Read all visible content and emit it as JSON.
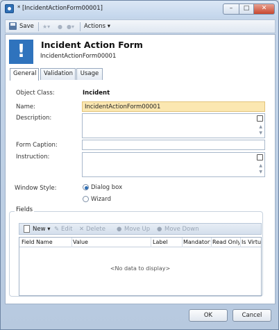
{
  "window": {
    "title": "* [IncidentActionForm00001]"
  },
  "toolbar": {
    "save_label": "Save",
    "actions_label": "Actions ▾"
  },
  "header": {
    "title": "Incident Action Form",
    "subtitle": "IncidentActionForm00001",
    "icon_glyph": "!"
  },
  "tabs": [
    {
      "label": "General"
    },
    {
      "label": "Validation"
    },
    {
      "label": "Usage"
    }
  ],
  "form": {
    "object_class_label": "Object Class:",
    "object_class_value": "Incident",
    "name_label": "Name:",
    "name_value": "IncidentActionForm00001",
    "description_label": "Description:",
    "description_value": "",
    "form_caption_label": "Form Caption:",
    "form_caption_value": "",
    "instruction_label": "Instruction:",
    "instruction_value": "",
    "window_style_label": "Window Style:",
    "window_style_options": [
      "Dialog box",
      "Wizard"
    ],
    "window_style_selected": "Dialog box"
  },
  "fields": {
    "group_title": "Fields",
    "toolbar": {
      "new_label": "New ▾",
      "edit_label": "Edit",
      "delete_label": "Delete",
      "move_up_label": "Move Up",
      "move_down_label": "Move Down"
    },
    "columns": [
      "Field Name",
      "Value",
      "Label",
      "Mandatory",
      "Read Only",
      "Is Virtual"
    ],
    "empty_message": "<No data to display>"
  },
  "buttons": {
    "ok_label": "OK",
    "cancel_label": "Cancel"
  },
  "colors": {
    "accent": "#2f73bd",
    "focused_input": "#fbe7b1",
    "window_frame": "#c5d6ea"
  }
}
